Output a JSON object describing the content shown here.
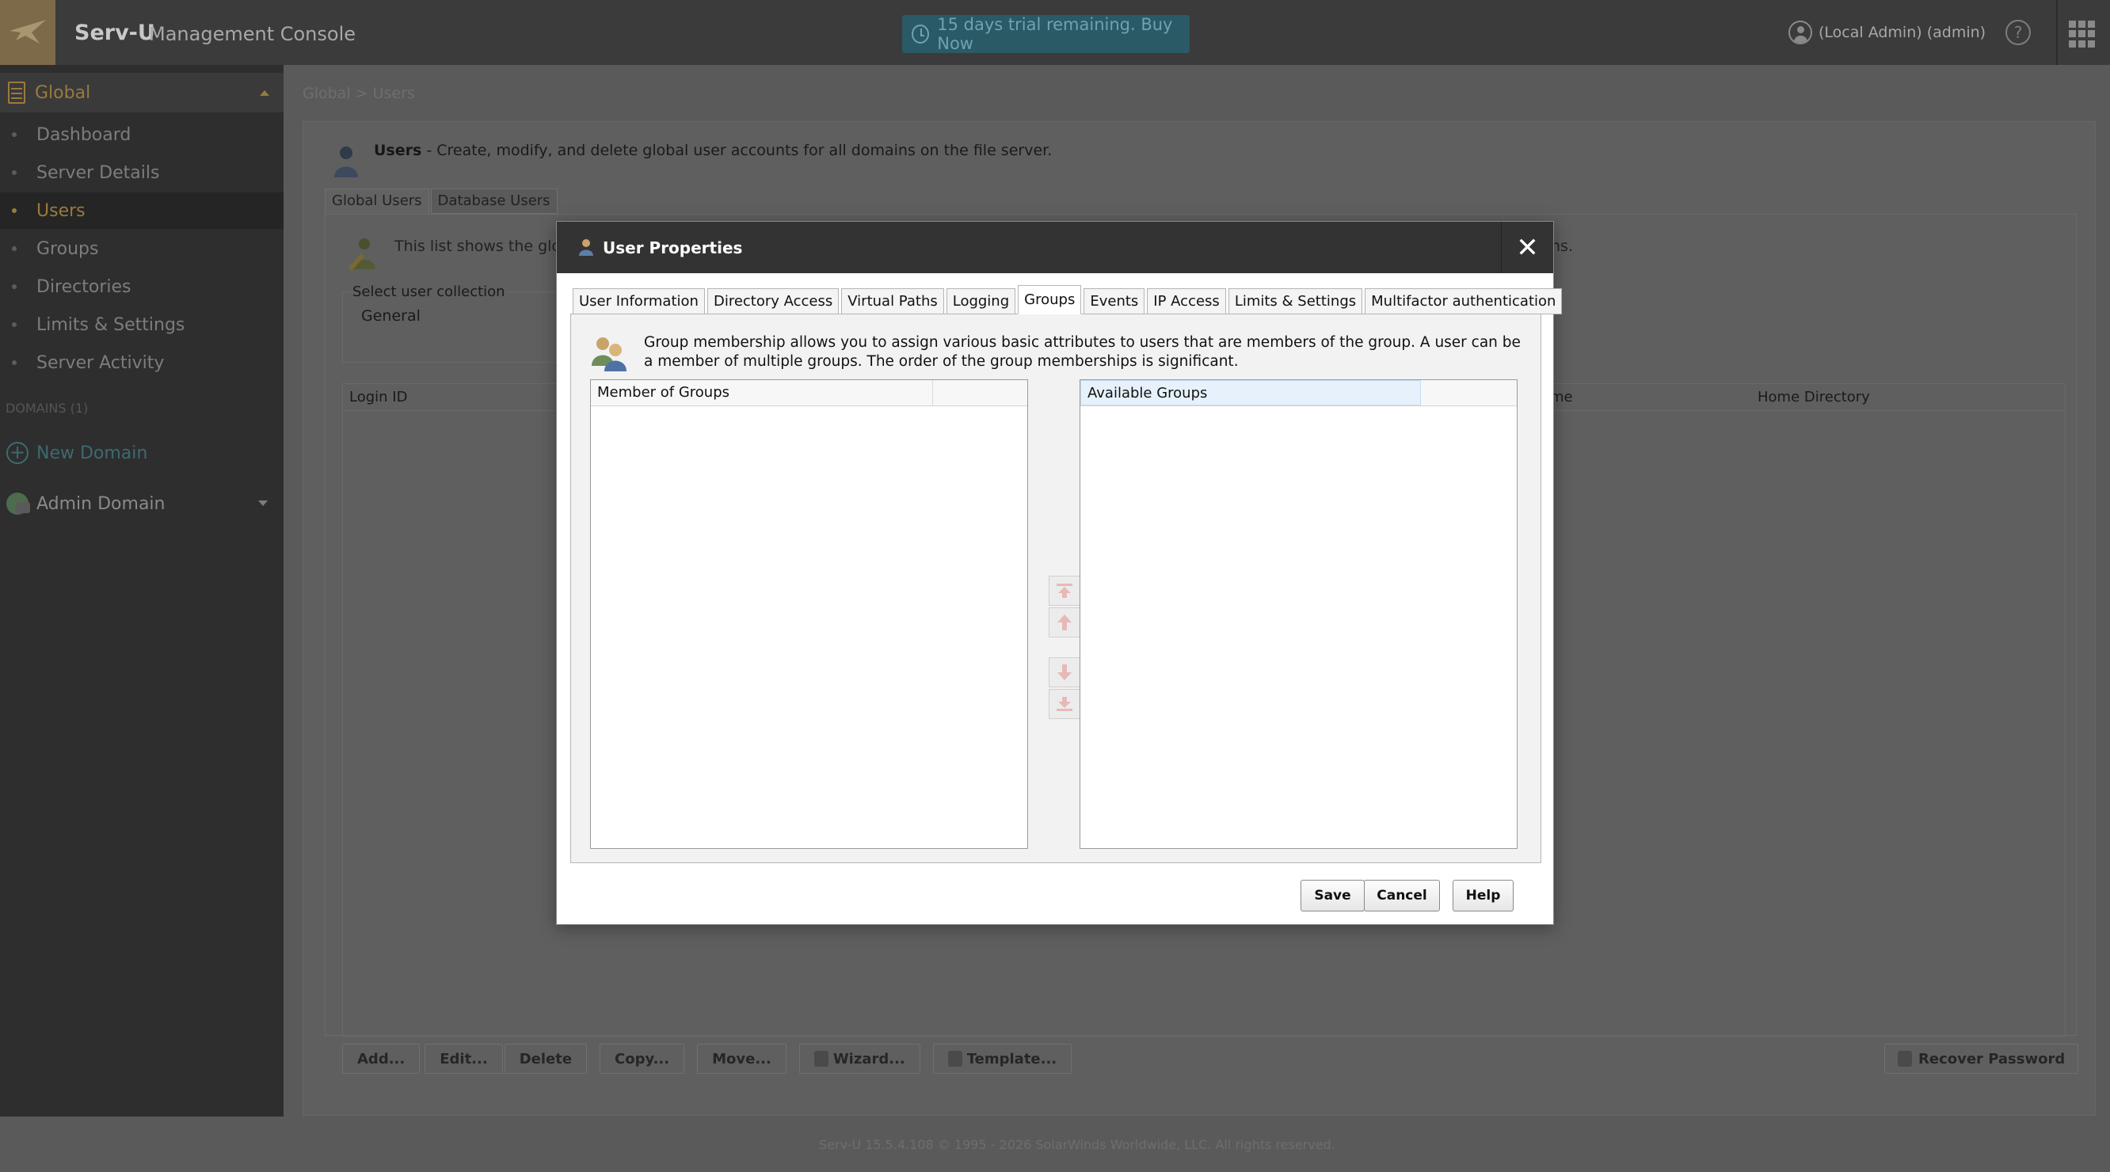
{
  "header": {
    "app_name": "Serv-U",
    "app_subtitle": "Management Console",
    "trial_text": "15 days trial remaining. Buy Now",
    "user_label": "(Local Admin) (admin)",
    "help_label": "?"
  },
  "sidebar": {
    "section_title": "Global",
    "items": [
      {
        "label": "Dashboard"
      },
      {
        "label": "Server Details"
      },
      {
        "label": "Users"
      },
      {
        "label": "Groups"
      },
      {
        "label": "Directories"
      },
      {
        "label": "Limits & Settings"
      },
      {
        "label": "Server Activity"
      }
    ],
    "active_item": "Users",
    "domains_label": "DOMAINS (1)",
    "new_domain_label": "New Domain",
    "admin_domain_label": "Admin Domain"
  },
  "page": {
    "breadcrumb": "Global  >  Users",
    "users_title": "Users",
    "users_description": " - Create, modify, and delete global user accounts for all domains on the file server.",
    "tabs": [
      {
        "label": "Global Users"
      },
      {
        "label": "Database Users"
      }
    ],
    "list_description_start": "This list shows the global",
    "list_description_end": "ns.",
    "collection_legend": "Select user collection",
    "collection_value": "General",
    "columns": {
      "login_id": "Login ID",
      "name_partial": "me",
      "home_directory": "Home Directory"
    },
    "buttons": {
      "add": "Add...",
      "edit": "Edit...",
      "delete": "Delete",
      "copy": "Copy...",
      "move": "Move...",
      "wizard": "Wizard...",
      "template": "Template...",
      "recover": "Recover Password"
    },
    "footer": "Serv-U 15.5.4.108 © 1995 - 2026 SolarWinds Worldwide, LLC. All rights reserved."
  },
  "modal": {
    "title": "User Properties",
    "close_label": "✕",
    "tabs": [
      {
        "label": "User Information"
      },
      {
        "label": "Directory Access"
      },
      {
        "label": "Virtual Paths"
      },
      {
        "label": "Logging"
      },
      {
        "label": "Groups"
      },
      {
        "label": "Events"
      },
      {
        "label": "IP Access"
      },
      {
        "label": "Limits & Settings"
      },
      {
        "label": "Multifactor authentication"
      }
    ],
    "selected_tab": "Groups",
    "groups_description": "Group membership allows you to assign various basic attributes to users that are members of the group. A user can be a member of multiple groups. The order of the group memberships is significant.",
    "member_of_groups_header": "Member of Groups",
    "available_groups_header": "Available Groups",
    "save_label": "Save",
    "cancel_label": "Cancel",
    "help_label": "Help"
  },
  "colors": {
    "accent_gold": "#9a7a3e",
    "topbar": "#3b3b3b",
    "trial_bg": "#2a5a66",
    "modal_header": "#333333"
  }
}
